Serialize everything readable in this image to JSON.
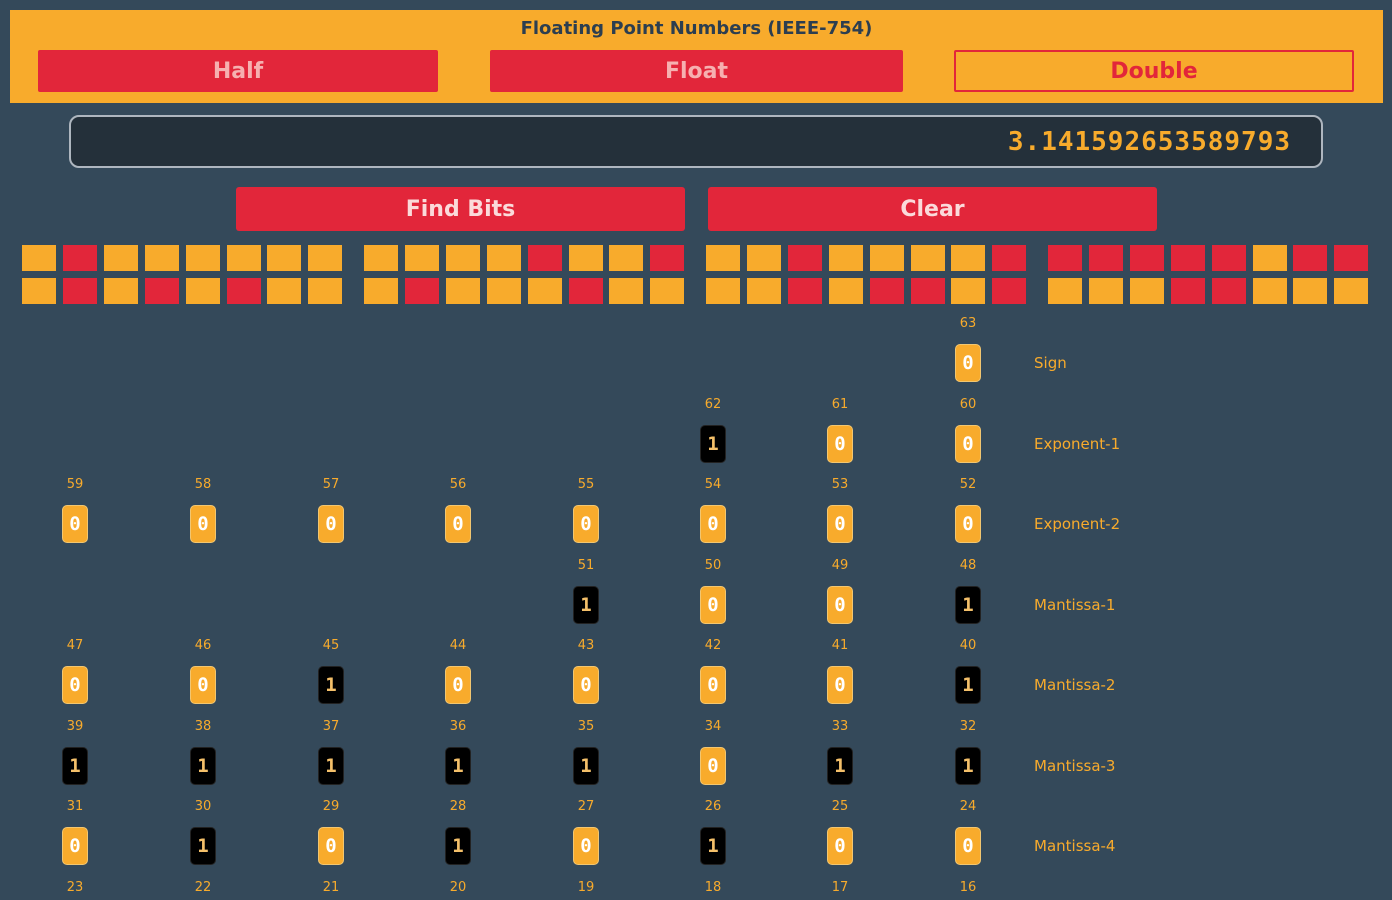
{
  "app": {
    "title": "Floating Point Numbers (IEEE-754)"
  },
  "modes": [
    {
      "label": "Half",
      "selected": false
    },
    {
      "label": "Float",
      "selected": false
    },
    {
      "label": "Double",
      "selected": true
    }
  ],
  "input": {
    "value": "3.141592653589793"
  },
  "actions": {
    "find_bits_label": "Find Bits",
    "clear_label": "Clear"
  },
  "colors": {
    "accent": "#f8ab2c",
    "danger": "#e2263a",
    "background": "#34495a"
  },
  "bit_grid": {
    "row1": [
      "Y",
      "R",
      "Y",
      "Y",
      "Y",
      "Y",
      "Y",
      "Y",
      "Y",
      "Y",
      "Y",
      "Y",
      "R",
      "Y",
      "Y",
      "R",
      "Y",
      "Y",
      "R",
      "Y",
      "Y",
      "Y",
      "Y",
      "R",
      "R",
      "R",
      "R",
      "R",
      "R",
      "Y",
      "R",
      "R"
    ],
    "row2": [
      "Y",
      "R",
      "Y",
      "R",
      "Y",
      "R",
      "Y",
      "Y",
      "Y",
      "R",
      "Y",
      "Y",
      "Y",
      "R",
      "Y",
      "Y",
      "Y",
      "Y",
      "R",
      "Y",
      "R",
      "R",
      "Y",
      "R",
      "Y",
      "Y",
      "Y",
      "R",
      "R",
      "Y",
      "Y",
      "Y"
    ]
  },
  "bit_rows": [
    {
      "label": "Sign",
      "bits": [
        {
          "pos": "63",
          "val": "0"
        }
      ]
    },
    {
      "label": "Exponent-1",
      "bits": [
        {
          "pos": "62",
          "val": "1"
        },
        {
          "pos": "61",
          "val": "0"
        },
        {
          "pos": "60",
          "val": "0"
        }
      ]
    },
    {
      "label": "Exponent-2",
      "bits": [
        {
          "pos": "59",
          "val": "0"
        },
        {
          "pos": "58",
          "val": "0"
        },
        {
          "pos": "57",
          "val": "0"
        },
        {
          "pos": "56",
          "val": "0"
        },
        {
          "pos": "55",
          "val": "0"
        },
        {
          "pos": "54",
          "val": "0"
        },
        {
          "pos": "53",
          "val": "0"
        },
        {
          "pos": "52",
          "val": "0"
        }
      ]
    },
    {
      "label": "Mantissa-1",
      "bits": [
        {
          "pos": "51",
          "val": "1"
        },
        {
          "pos": "50",
          "val": "0"
        },
        {
          "pos": "49",
          "val": "0"
        },
        {
          "pos": "48",
          "val": "1"
        }
      ]
    },
    {
      "label": "Mantissa-2",
      "bits": [
        {
          "pos": "47",
          "val": "0"
        },
        {
          "pos": "46",
          "val": "0"
        },
        {
          "pos": "45",
          "val": "1"
        },
        {
          "pos": "44",
          "val": "0"
        },
        {
          "pos": "43",
          "val": "0"
        },
        {
          "pos": "42",
          "val": "0"
        },
        {
          "pos": "41",
          "val": "0"
        },
        {
          "pos": "40",
          "val": "1"
        }
      ]
    },
    {
      "label": "Mantissa-3",
      "bits": [
        {
          "pos": "39",
          "val": "1"
        },
        {
          "pos": "38",
          "val": "1"
        },
        {
          "pos": "37",
          "val": "1"
        },
        {
          "pos": "36",
          "val": "1"
        },
        {
          "pos": "35",
          "val": "1"
        },
        {
          "pos": "34",
          "val": "0"
        },
        {
          "pos": "33",
          "val": "1"
        },
        {
          "pos": "32",
          "val": "1"
        }
      ]
    },
    {
      "label": "Mantissa-4",
      "bits": [
        {
          "pos": "31",
          "val": "0"
        },
        {
          "pos": "30",
          "val": "1"
        },
        {
          "pos": "29",
          "val": "0"
        },
        {
          "pos": "28",
          "val": "1"
        },
        {
          "pos": "27",
          "val": "0"
        },
        {
          "pos": "26",
          "val": "1"
        },
        {
          "pos": "25",
          "val": "0"
        },
        {
          "pos": "24",
          "val": "0"
        }
      ]
    }
  ],
  "partial_row": {
    "positions": [
      "23",
      "22",
      "21",
      "20",
      "19",
      "18",
      "17",
      "16"
    ]
  }
}
